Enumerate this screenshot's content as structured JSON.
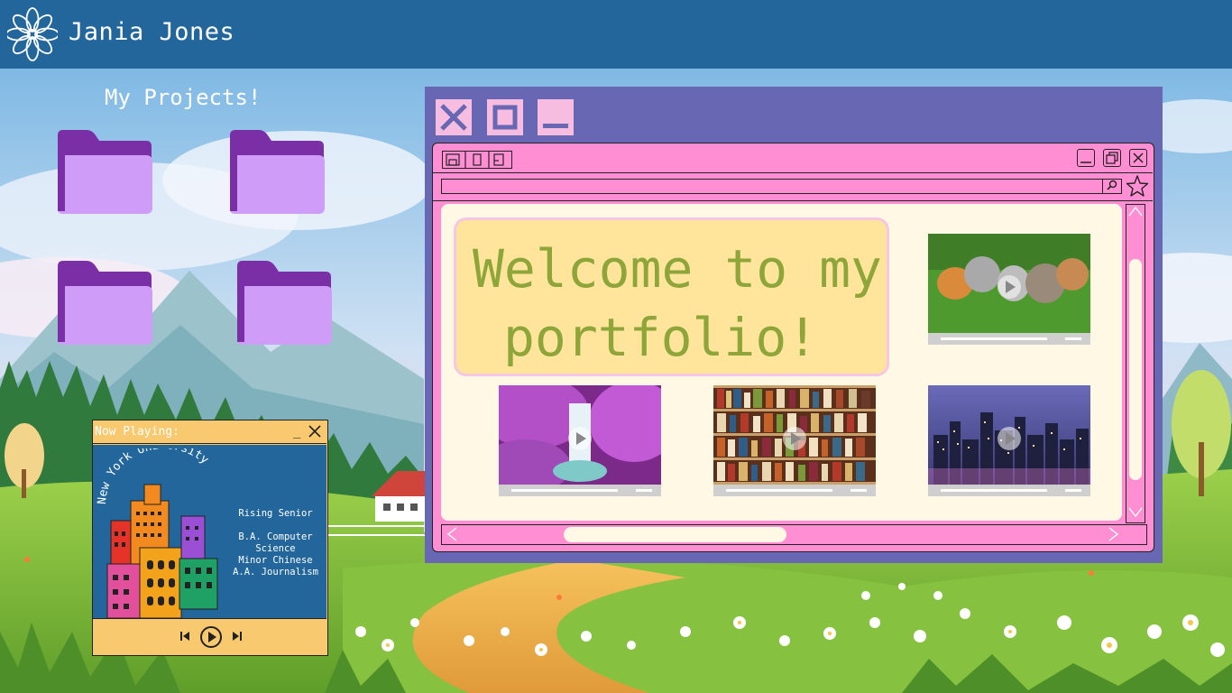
{
  "header": {
    "site_name": "Jania Jones",
    "logo_icon": "flower-icon"
  },
  "projects": {
    "title": "My Projects!",
    "folders": [
      "folder-icon",
      "folder-icon",
      "folder-icon",
      "folder-icon"
    ]
  },
  "player": {
    "title": "Now Playing:",
    "min_label": "_",
    "album_art_text": "New York University",
    "info_lines": [
      "Rising Senior",
      "",
      "B.A. Computer",
      "Science",
      "Minor Chinese",
      "A.A. Journalism"
    ],
    "controls": [
      "previous-icon",
      "play-icon",
      "next-icon"
    ]
  },
  "browser": {
    "window_buttons": [
      "close-icon",
      "maximize-icon",
      "minimize-icon"
    ],
    "welcome_line1": "Welcome to my",
    "welcome_line2": "portfolio!",
    "videos": [
      {
        "subject": "kittens"
      },
      {
        "subject": "waterfall"
      },
      {
        "subject": "bookshelf"
      },
      {
        "subject": "city-night"
      }
    ]
  },
  "colors": {
    "header": "#22669c",
    "outer_window": "#6767b3",
    "inner_window": "#ff8fd2",
    "content_bg": "#fff8e4",
    "welcome_bg": "#ffe59c",
    "welcome_text": "#8ea53a",
    "folder": "#cf9df7",
    "folder_tab": "#7b2fa6",
    "player_accent": "#f9c970"
  }
}
